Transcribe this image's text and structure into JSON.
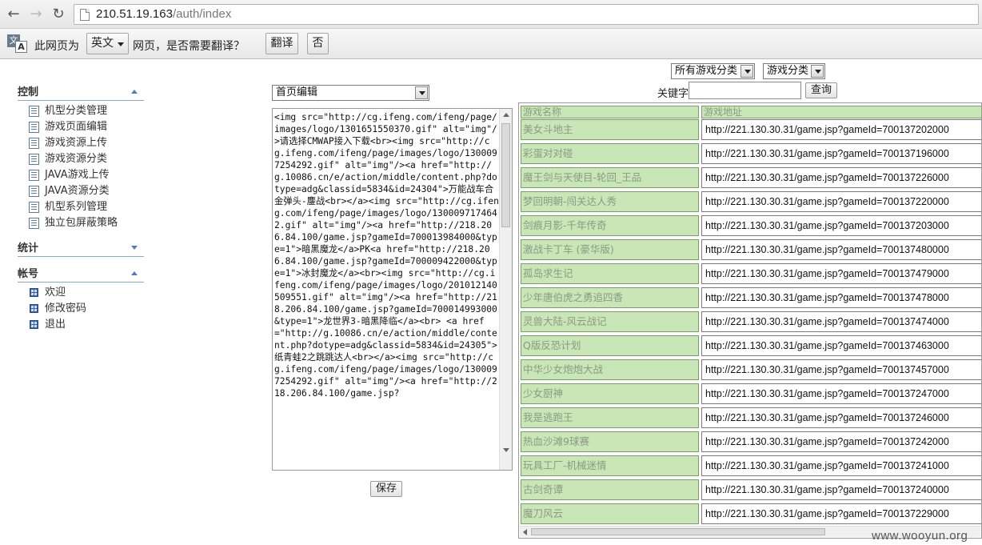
{
  "browser": {
    "url_host": "210.51.19.163",
    "url_path": "/auth/index"
  },
  "translate_bar": {
    "prefix": "此网页为",
    "language": "英文",
    "suffix": "网页，是否需要翻译？",
    "translate_label": "翻译",
    "no_label": "否"
  },
  "sidebar": {
    "sections": [
      {
        "title": "控制",
        "expanded": true,
        "items": [
          "机型分类管理",
          "游戏页面编辑",
          "游戏资源上传",
          "游戏资源分类",
          "JAVA游戏上传",
          "JAVA资源分类",
          "机型系列管理",
          "独立包屏蔽策略"
        ]
      },
      {
        "title": "统计",
        "expanded": false,
        "items": []
      },
      {
        "title": "帐号",
        "expanded": true,
        "items": [
          "欢迎",
          "修改密码",
          "退出"
        ]
      }
    ]
  },
  "editor": {
    "page_select": "首页编辑",
    "content": "<img src=\"http://cg.ifeng.com/ifeng/page/images/logo/1301651550370.gif\" alt=\"img\"/>请选择CMWAP接入下载<br><img src=\"http://cg.ifeng.com/ifeng/page/images/logo/1300097254292.gif\" alt=\"img\"/><a href=\"http://g.10086.cn/e/action/middle/content.php?dotype=adg&classid=5834&id=24304\">万能战车合金弹头-鏖战<br></a><img src=\"http://cg.ifeng.com/ifeng/page/images/logo/1300097174642.gif\" alt=\"img\"/><a href=\"http://218.206.84.100/game.jsp?gameId=700013984000&type=1\">暗黑魔龙</a>PK<a href=\"http://218.206.84.100/game.jsp?gameId=700009422000&type=1\">冰封魔龙</a><br><img src=\"http://cg.ifeng.com/ifeng/page/images/logo/201012140509551.gif\" alt=\"img\"/><a href=\"http://218.206.84.100/game.jsp?gameId=700014993000&type=1\">龙世界3-暗黑降临</a><br> <a href=\"http://g.10086.cn/e/action/middle/content.php?dotype=adg&classid=5834&id=24305\">纸青蛙2之跳跳达人<br></a><img src=\"http://cg.ifeng.com/ifeng/page/images/logo/1300097254292.gif\" alt=\"img\"/><a href=\"http://218.206.84.100/game.jsp?",
    "save_label": "保存"
  },
  "filters": {
    "category_all": "所有游戏分类",
    "category": "游戏分类",
    "keyword_label": "关键字",
    "keyword_value": "",
    "query_label": "查询"
  },
  "table": {
    "headers": [
      "游戏名称",
      "游戏地址"
    ],
    "rows": [
      {
        "name": "美女斗地主",
        "url": "http://221.130.30.31/game.jsp?gameId=700137202000"
      },
      {
        "name": "彩蛋对对碰",
        "url": "http://221.130.30.31/game.jsp?gameId=700137196000"
      },
      {
        "name": "魔王剑与天使目-轮回_王品",
        "url": "http://221.130.30.31/game.jsp?gameId=700137226000"
      },
      {
        "name": "梦回明朝-闯关达人秀",
        "url": "http://221.130.30.31/game.jsp?gameId=700137220000"
      },
      {
        "name": "剑痕月影-千年传奇",
        "url": "http://221.130.30.31/game.jsp?gameId=700137203000"
      },
      {
        "name": "激战卡丁车 (豪华版)",
        "url": "http://221.130.30.31/game.jsp?gameId=700137480000"
      },
      {
        "name": "孤岛求生记",
        "url": "http://221.130.30.31/game.jsp?gameId=700137479000"
      },
      {
        "name": "少年唐伯虎之勇追四香",
        "url": "http://221.130.30.31/game.jsp?gameId=700137478000"
      },
      {
        "name": "灵兽大陆-风云战记",
        "url": "http://221.130.30.31/game.jsp?gameId=700137474000"
      },
      {
        "name": "Q版反恐计划",
        "url": "http://221.130.30.31/game.jsp?gameId=700137463000"
      },
      {
        "name": "中华少女炮炮大战",
        "url": "http://221.130.30.31/game.jsp?gameId=700137457000"
      },
      {
        "name": "少女厨神",
        "url": "http://221.130.30.31/game.jsp?gameId=700137247000"
      },
      {
        "name": "我是逃跑王",
        "url": "http://221.130.30.31/game.jsp?gameId=700137246000"
      },
      {
        "name": "热血沙滩9球赛",
        "url": "http://221.130.30.31/game.jsp?gameId=700137242000"
      },
      {
        "name": "玩具工厂-机械迷情",
        "url": "http://221.130.30.31/game.jsp?gameId=700137241000"
      },
      {
        "name": "古剑奇谭",
        "url": "http://221.130.30.31/game.jsp?gameId=700137240000"
      },
      {
        "name": "魔刀风云",
        "url": "http://221.130.30.31/game.jsp?gameId=700137229000"
      }
    ]
  },
  "watermark": "www.wooyun.org"
}
